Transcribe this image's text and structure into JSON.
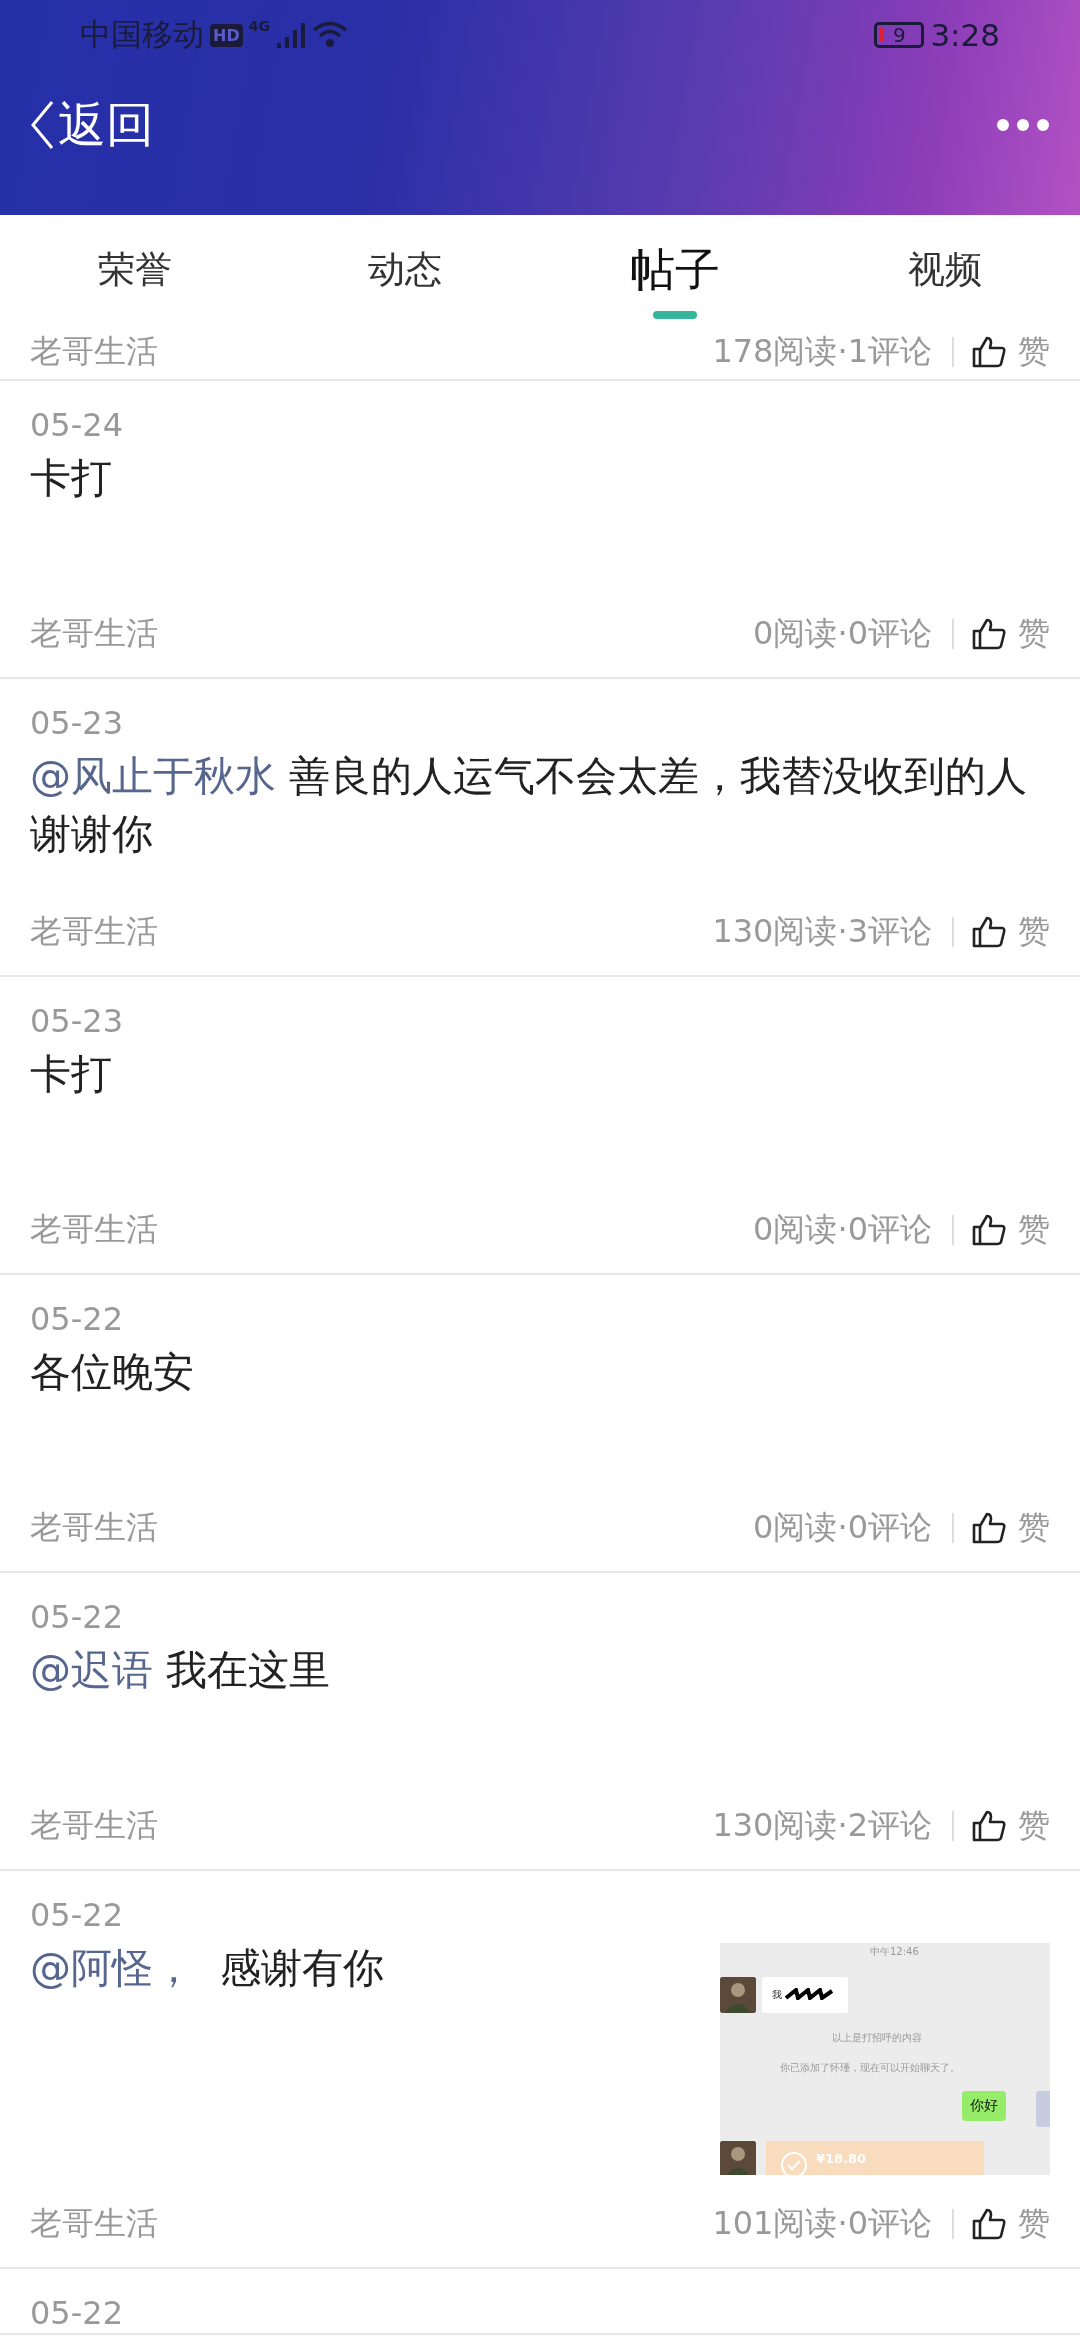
{
  "status_bar": {
    "carrier": "中国移动",
    "hd_badge": "HD",
    "network": "4G",
    "battery": "9",
    "time": "3:28"
  },
  "header": {
    "back_label": "返回"
  },
  "tabs": [
    {
      "label": "荣誉",
      "selected": false
    },
    {
      "label": "动态",
      "selected": false
    },
    {
      "label": "帖子",
      "selected": true
    },
    {
      "label": "视频",
      "selected": false
    }
  ],
  "partial_post": {
    "author": "老哥生活",
    "stats": "178阅读·1评论",
    "like_label": "赞"
  },
  "posts": [
    {
      "date": "05-24",
      "text": "卡打",
      "author": "老哥生活",
      "stats": "0阅读·0评论",
      "like_label": "赞"
    },
    {
      "date": "05-23",
      "mention": "@风止于秋水",
      "text": " 善良的人运气不会太差，我替没收到的人谢谢你",
      "author": "老哥生活",
      "stats": "130阅读·3评论",
      "like_label": "赞"
    },
    {
      "date": "05-23",
      "text": "卡打",
      "author": "老哥生活",
      "stats": "0阅读·0评论",
      "like_label": "赞"
    },
    {
      "date": "05-22",
      "text": "各位晚安",
      "author": "老哥生活",
      "stats": "0阅读·0评论",
      "like_label": "赞"
    },
    {
      "date": "05-22",
      "mention": "@迟语",
      "text": " 我在这里",
      "author": "老哥生活",
      "stats": "130阅读·2评论",
      "like_label": "赞"
    },
    {
      "date": "05-22",
      "mention": "@阿怪，",
      "text": "  感谢有你",
      "author": "老哥生活",
      "stats": "101阅读·0评论",
      "like_label": "赞",
      "thumbnail": {
        "time": "中午12:46",
        "greeting": "我",
        "notice": "以上是打招呼的内容",
        "added": "你已添加了怀瑾，现在可以开始聊天了。",
        "reply": "你好",
        "amount": "¥18.80"
      }
    },
    {
      "date": "05-22"
    }
  ]
}
